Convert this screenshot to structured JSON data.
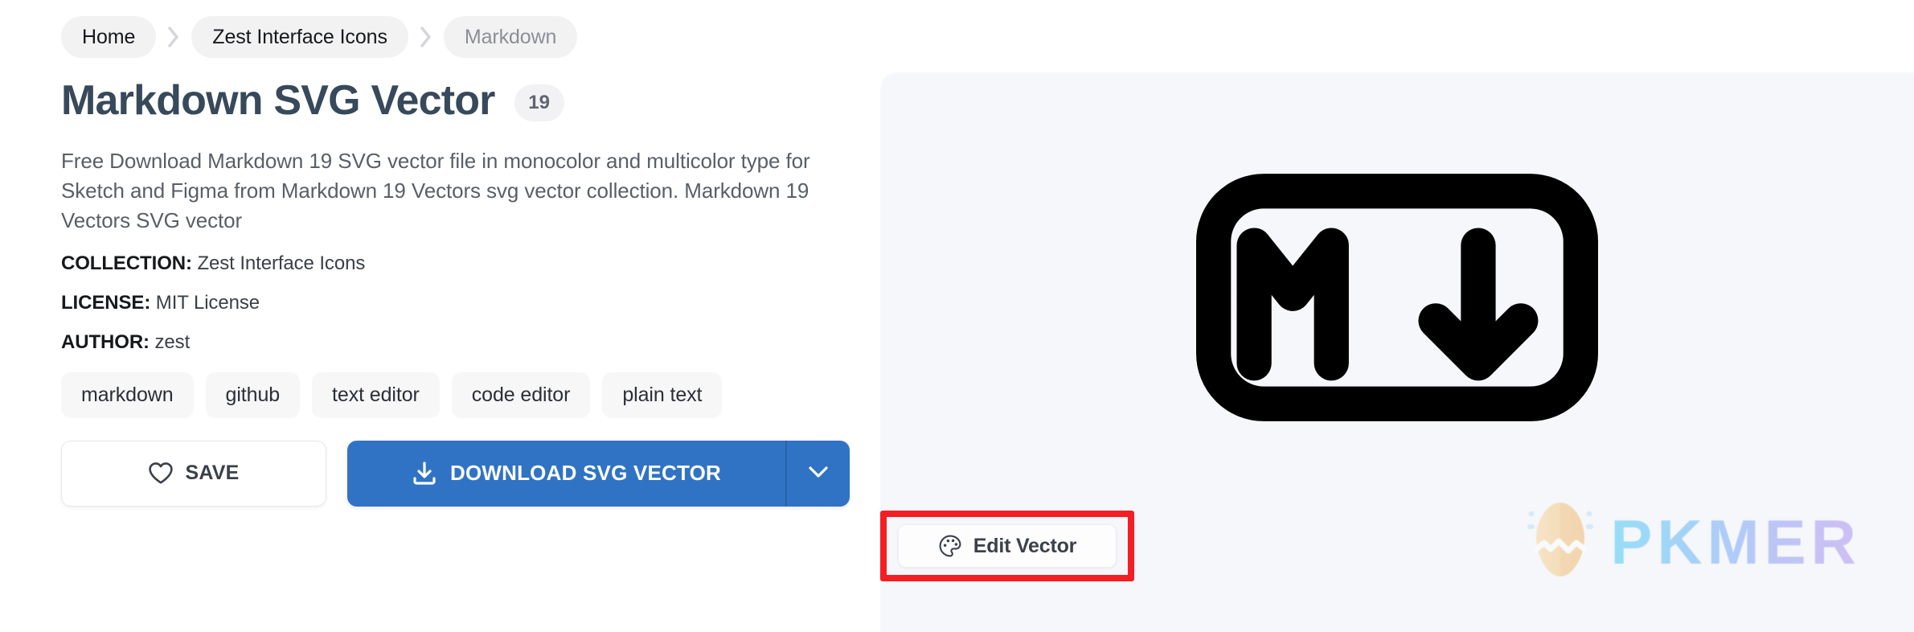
{
  "breadcrumb": {
    "items": [
      {
        "label": "Home",
        "current": false
      },
      {
        "label": "Zest Interface Icons",
        "current": false
      },
      {
        "label": "Markdown",
        "current": true
      }
    ]
  },
  "header": {
    "title": "Markdown SVG Vector",
    "count_badge": "19"
  },
  "description": "Free Download Markdown 19 SVG vector file in monocolor and multicolor type for Sketch and Figma from Markdown 19 Vectors svg vector collection. Markdown 19 Vectors SVG vector",
  "meta": [
    {
      "key": "COLLECTION:",
      "value": "Zest Interface Icons"
    },
    {
      "key": "LICENSE:",
      "value": "MIT License"
    },
    {
      "key": "AUTHOR:",
      "value": "zest"
    }
  ],
  "tags": [
    "markdown",
    "github",
    "text editor",
    "code editor",
    "plain text"
  ],
  "actions": {
    "save_label": "SAVE",
    "download_label": "DOWNLOAD SVG VECTOR",
    "download_caret_label": "",
    "save_icon": "heart-icon",
    "download_icon": "download-icon",
    "caret_icon": "chevron-down-icon"
  },
  "preview": {
    "icon_name": "markdown-logo",
    "edit_label": "Edit Vector",
    "edit_icon": "palette-icon",
    "highlight_color": "#f41e24"
  },
  "watermark": {
    "text": "PKMER",
    "logo_name": "pkmer-egg-logo"
  },
  "colors": {
    "accent_blue": "#3073c4",
    "title": "#37495a",
    "panel_bg": "#f6f7fb",
    "chip_bg": "#f2f2f3",
    "tag_bg": "#f7f7f8",
    "highlight_red": "#f41e24"
  }
}
